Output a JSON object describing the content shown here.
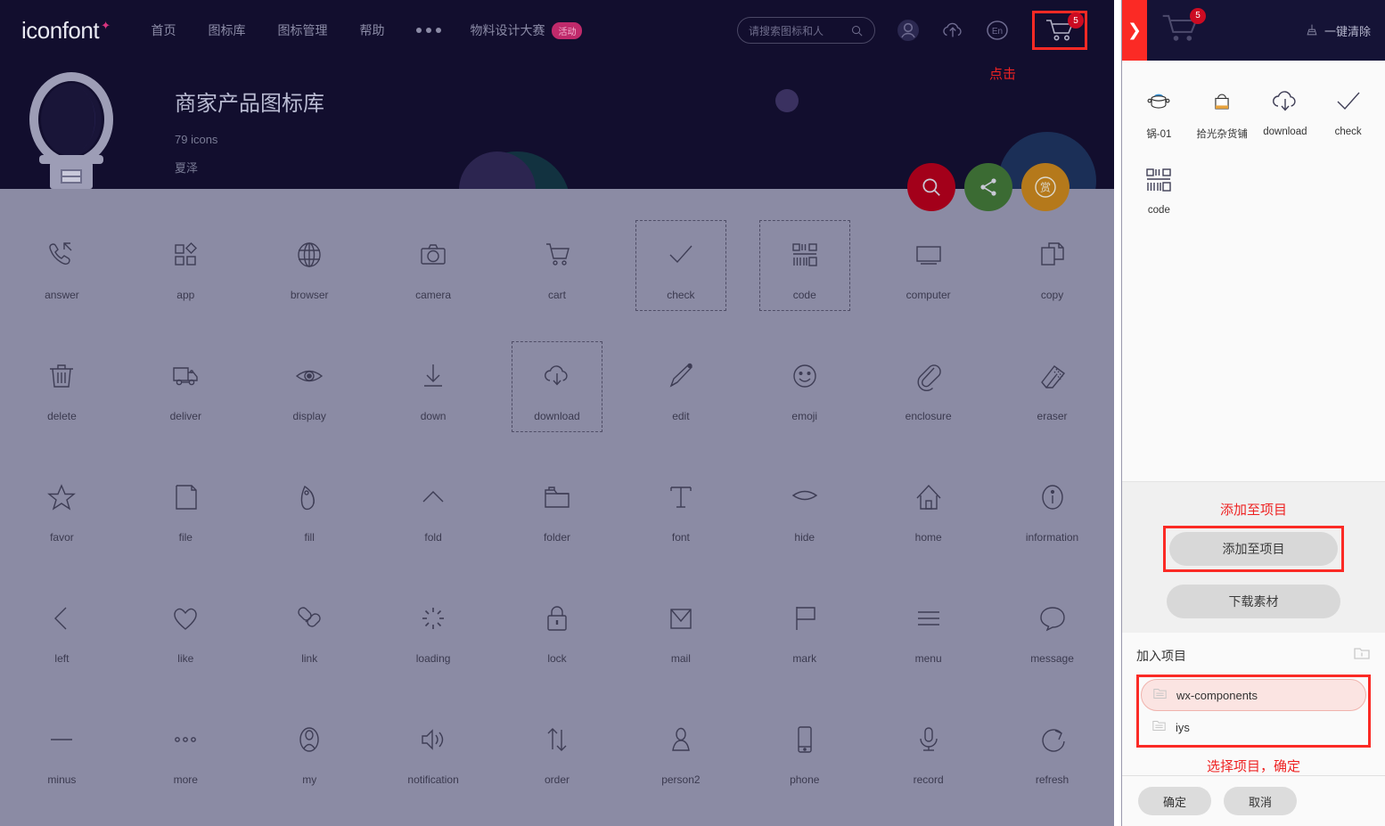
{
  "header": {
    "logo": "iconfont",
    "nav": [
      {
        "label": "首页"
      },
      {
        "label": "图标库"
      },
      {
        "label": "图标管理"
      },
      {
        "label": "帮助"
      }
    ],
    "more_icon": "more-dots-icon",
    "promo_label": "物料设计大赛",
    "promo_badge": "活动",
    "search_placeholder": "请搜索图标和人",
    "search_icon": "search-icon",
    "icons": [
      "user-avatar-icon",
      "upload-cloud-icon",
      "language-en-icon"
    ],
    "cart_icon": "shopping-cart-icon",
    "cart_count": "5",
    "click_annotation": "点击"
  },
  "banner": {
    "title": "商家产品图标库",
    "icon_count": "79 icons",
    "author": "夏泽",
    "fabs": [
      {
        "name": "search-fab",
        "icon": "search-icon",
        "color": "#a3001a"
      },
      {
        "name": "share-fab",
        "icon": "share-icon",
        "color": "#3b6b33"
      },
      {
        "name": "reward-fab",
        "icon": "reward-icon",
        "label": "赏",
        "color": "#b5791b"
      }
    ]
  },
  "grid": {
    "icons": [
      {
        "label": "answer",
        "icon": "phone-answer-icon",
        "selected": false
      },
      {
        "label": "app",
        "icon": "app-grid-icon",
        "selected": false
      },
      {
        "label": "browser",
        "icon": "globe-icon",
        "selected": false
      },
      {
        "label": "camera",
        "icon": "camera-icon",
        "selected": false
      },
      {
        "label": "cart",
        "icon": "cart-icon",
        "selected": false
      },
      {
        "label": "check",
        "icon": "check-icon",
        "selected": true
      },
      {
        "label": "code",
        "icon": "qrcode-icon",
        "selected": true
      },
      {
        "label": "computer",
        "icon": "monitor-icon",
        "selected": false
      },
      {
        "label": "copy",
        "icon": "copy-icon",
        "selected": false
      },
      {
        "label": "delete",
        "icon": "trash-icon",
        "selected": false
      },
      {
        "label": "deliver",
        "icon": "truck-icon",
        "selected": false
      },
      {
        "label": "display",
        "icon": "eye-icon",
        "selected": false
      },
      {
        "label": "down",
        "icon": "arrow-down-icon",
        "selected": false
      },
      {
        "label": "download",
        "icon": "cloud-download-icon",
        "selected": true
      },
      {
        "label": "edit",
        "icon": "pencil-icon",
        "selected": false
      },
      {
        "label": "emoji",
        "icon": "smiley-icon",
        "selected": false
      },
      {
        "label": "enclosure",
        "icon": "paperclip-icon",
        "selected": false
      },
      {
        "label": "eraser",
        "icon": "eraser-icon",
        "selected": false
      },
      {
        "label": "favor",
        "icon": "star-icon",
        "selected": false
      },
      {
        "label": "file",
        "icon": "file-icon",
        "selected": false
      },
      {
        "label": "fill",
        "icon": "paint-fill-icon",
        "selected": false
      },
      {
        "label": "fold",
        "icon": "chevron-up-icon",
        "selected": false
      },
      {
        "label": "folder",
        "icon": "folder-icon",
        "selected": false
      },
      {
        "label": "font",
        "icon": "text-t-icon",
        "selected": false
      },
      {
        "label": "hide",
        "icon": "eye-hide-icon",
        "selected": false
      },
      {
        "label": "home",
        "icon": "home-icon",
        "selected": false
      },
      {
        "label": "information",
        "icon": "info-circle-icon",
        "selected": false
      },
      {
        "label": "left",
        "icon": "chevron-left-icon",
        "selected": false
      },
      {
        "label": "like",
        "icon": "heart-icon",
        "selected": false
      },
      {
        "label": "link",
        "icon": "link-icon",
        "selected": false
      },
      {
        "label": "loading",
        "icon": "spinner-icon",
        "selected": false
      },
      {
        "label": "lock",
        "icon": "lock-icon",
        "selected": false
      },
      {
        "label": "mail",
        "icon": "envelope-icon",
        "selected": false
      },
      {
        "label": "mark",
        "icon": "flag-icon",
        "selected": false
      },
      {
        "label": "menu",
        "icon": "hamburger-menu-icon",
        "selected": false
      },
      {
        "label": "message",
        "icon": "speech-bubble-icon",
        "selected": false
      },
      {
        "label": "minus",
        "icon": "minus-icon",
        "selected": false
      },
      {
        "label": "more",
        "icon": "more-dots-icon",
        "selected": false
      },
      {
        "label": "my",
        "icon": "person-icon",
        "selected": false
      },
      {
        "label": "notification",
        "icon": "speaker-icon",
        "selected": false
      },
      {
        "label": "order",
        "icon": "sort-arrows-icon",
        "selected": false
      },
      {
        "label": "person2",
        "icon": "person-solid-icon",
        "selected": false
      },
      {
        "label": "phone",
        "icon": "mobile-phone-icon",
        "selected": false
      },
      {
        "label": "record",
        "icon": "microphone-icon",
        "selected": false
      },
      {
        "label": "refresh",
        "icon": "refresh-icon",
        "selected": false
      }
    ]
  },
  "panel": {
    "collapse_icon": "chevron-right-icon",
    "cart_icon": "shopping-cart-icon",
    "cart_count": "5",
    "clear_all_label": "一键清除",
    "clear_all_icon": "broom-icon",
    "cart_items": [
      {
        "label": "锅-01",
        "icon": "pot-icon"
      },
      {
        "label": "拾光杂货铺",
        "icon": "bag-icon"
      },
      {
        "label": "download",
        "icon": "cloud-download-icon"
      },
      {
        "label": "check",
        "icon": "check-icon"
      },
      {
        "label": "code",
        "icon": "qrcode-icon"
      }
    ],
    "annotation_add": "添加至项目",
    "add_to_project_label": "添加至项目",
    "download_assets_label": "下载素材",
    "projects_title": "加入项目",
    "new_project_icon": "new-folder-icon",
    "projects": [
      {
        "label": "wx-components",
        "icon": "folder-list-icon",
        "active": true
      },
      {
        "label": "iys",
        "icon": "folder-list-icon",
        "active": false
      }
    ],
    "annotation_select": "选择项目，确定",
    "confirm_label": "确定",
    "cancel_label": "取消"
  },
  "colors": {
    "brand_red": "#fb2a25",
    "nav_bg": "#120e2e",
    "panel_bg": "#fafafa",
    "overlay": "#8b8ba4",
    "annotation": "#ee2222"
  }
}
